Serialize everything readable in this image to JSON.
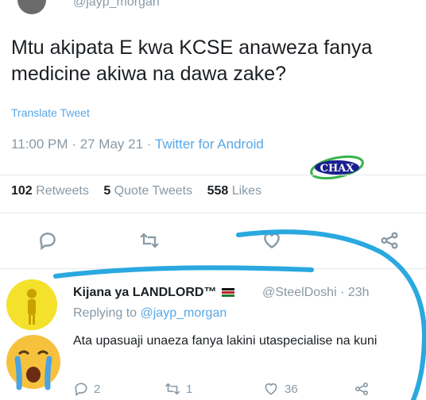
{
  "tweet": {
    "handle": "@jayp_morgan",
    "text": "Mtu akipata E kwa KCSE anaweza fanya medicine akiwa na dawa zake?",
    "translate_label": "Translate Tweet",
    "time": "11:00 PM",
    "date": "27 May 21",
    "source": "Twitter for Android",
    "retweets_count": "102",
    "retweets_label": "Retweets",
    "quotes_count": "5",
    "quotes_label": "Quote Tweets",
    "likes_count": "558",
    "likes_label": "Likes"
  },
  "watermark": {
    "text": "CHAX"
  },
  "actions": [
    {
      "icon": "reply-icon"
    },
    {
      "icon": "retweet-icon"
    },
    {
      "icon": "like-icon"
    },
    {
      "icon": "share-icon"
    }
  ],
  "reply": {
    "name": "Kijana ya LANDLORD™",
    "handle": "@SteelDoshi",
    "time": "23h",
    "replying_prefix": "Replying to",
    "replying_to": "@jayp_morgan",
    "text": "Ata upasuaji unaeza fanya lakini utaspecialise na kuni",
    "reply_count": "2",
    "retweet_count": "1",
    "like_count": "36"
  },
  "colors": {
    "link": "#58a7e6",
    "muted": "#8899a6",
    "annotation": "#2aa8e0"
  }
}
